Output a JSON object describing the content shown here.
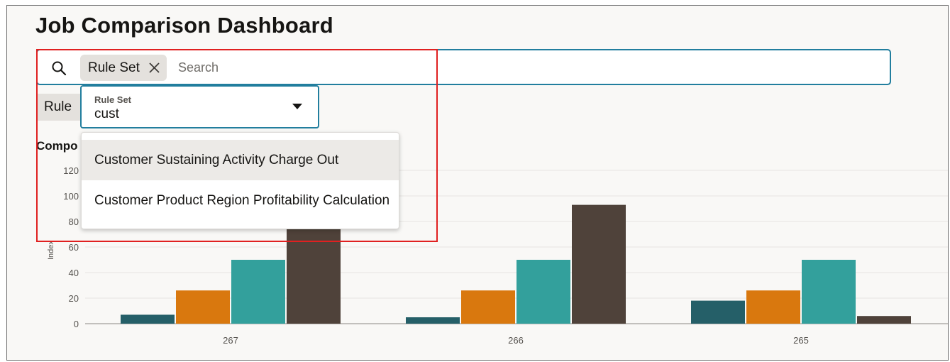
{
  "page": {
    "title": "Job Comparison Dashboard"
  },
  "search": {
    "chip_label": "Rule Set",
    "placeholder": "Search",
    "value": ""
  },
  "filter": {
    "rule_tab": "Rule",
    "field_label": "Rule Set",
    "field_value": "cust",
    "options": [
      "Customer Sustaining Activity Charge Out",
      "Customer Product Region Profitability Calculation"
    ],
    "highlighted_option": 0
  },
  "chart_data": {
    "type": "bar",
    "title": "Compo",
    "categories": [
      "267",
      "266",
      "265"
    ],
    "ylabel": "Index",
    "ylim": [
      0,
      120
    ],
    "yticks": [
      "0",
      "20",
      "40",
      "60",
      "80",
      "100",
      "120"
    ],
    "grid": true,
    "series": [
      {
        "values": [
          7,
          5,
          18
        ],
        "color": "#255f68"
      },
      {
        "values": [
          26,
          26,
          26
        ],
        "color": "#d9780e"
      },
      {
        "values": [
          50,
          50,
          50
        ],
        "color": "#33a09c"
      },
      {
        "values": [
          76,
          93,
          6
        ],
        "color": "#4f423a"
      }
    ]
  },
  "colors": {
    "accent": "#227e9e",
    "highlight": "#e02020",
    "chip": "#e4e1dd"
  }
}
